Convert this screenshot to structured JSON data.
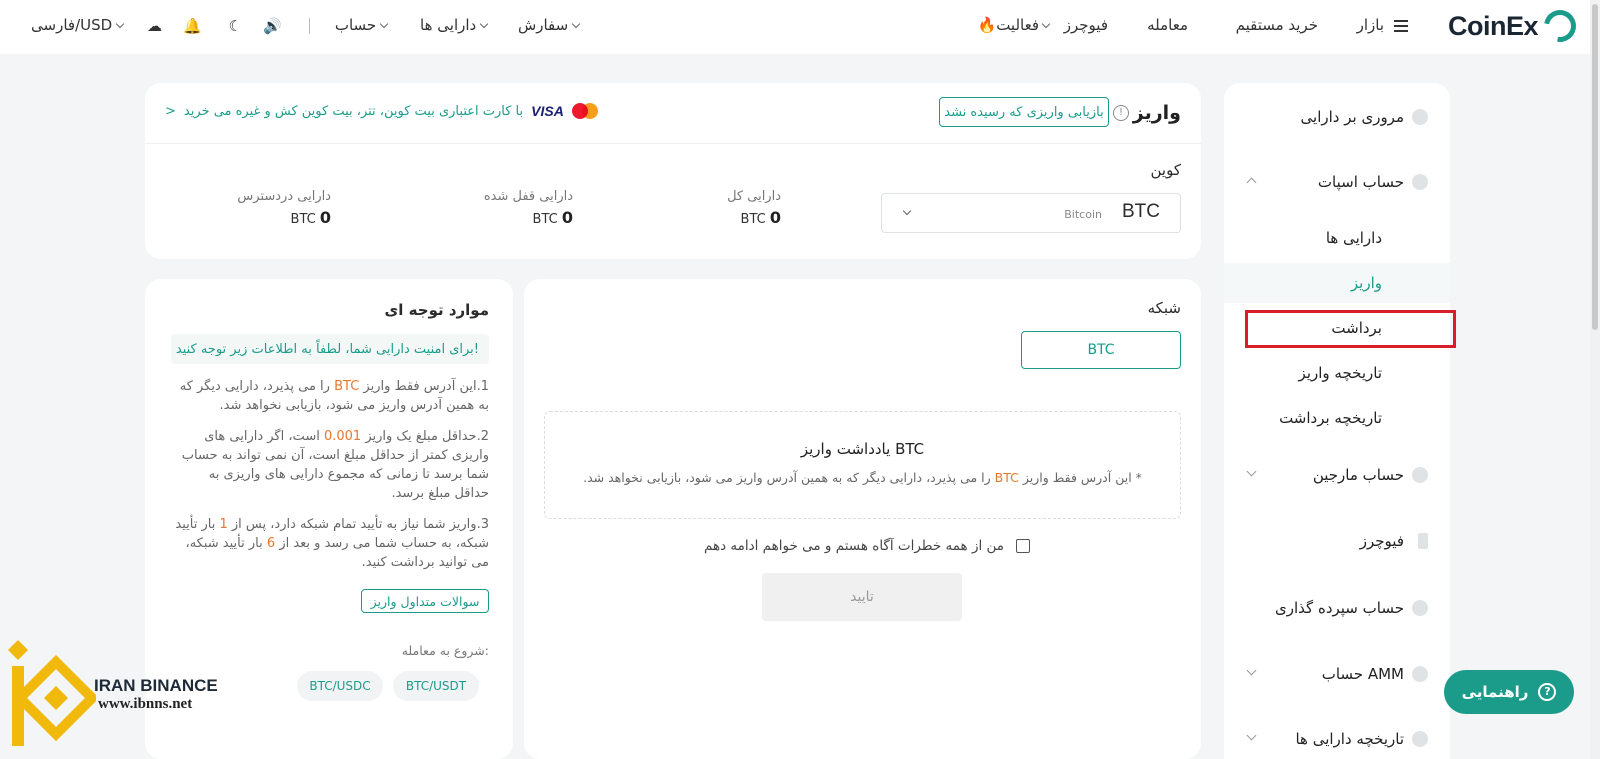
{
  "brand": {
    "name": "CoinEx",
    "color": "#1b9c8b"
  },
  "topnav": {
    "items": [
      "بازار",
      "خرید مستقیم",
      "معامله",
      "فیوچرز",
      "فعالیت",
      "سفارش",
      "دارایی ها",
      "حساب"
    ],
    "language": "فارسی/USD"
  },
  "sidebar": {
    "overview": "مروری بر دارایی",
    "spot": "حساب اسپات",
    "assets": "دارایی ها",
    "deposit": "واریز",
    "withdraw": "برداشت",
    "deposit_history": "تاریخچه واریز",
    "withdraw_history": "تاریخچه برداشت",
    "margin": "حساب مارجین",
    "futures": "فیوچرز",
    "savings": "حساب سپرده گذاری",
    "amm": "حساب AMM",
    "asset_history": "تاریخچه دارایی ها"
  },
  "deposit": {
    "title": "واریز",
    "recover_button": "بازیابی واریزی که رسیده نشد",
    "card_promo": "با کارت اعتباری بیت کوین، تتر، بیت کوین کش و غیره می خرید",
    "visa": "VISA",
    "coin_label": "کوین",
    "coin_symbol": "BTC",
    "coin_name": "Bitcoin",
    "balances": [
      {
        "label": "دارایی کل",
        "value": "0",
        "unit": "BTC"
      },
      {
        "label": "دارایی قفل شده",
        "value": "0",
        "unit": "BTC"
      },
      {
        "label": "دارایی دردسترس",
        "value": "0",
        "unit": "BTC"
      }
    ]
  },
  "network": {
    "label": "شبکه",
    "selected": "BTC",
    "memo_title": "یادداشت واریز BTC",
    "memo_text_pre": "* این آدرس فقط واریز",
    "memo_text_coin": "BTC",
    "memo_text_post": "را می پذیرد، دارایی دیگر که به همین آدرس واریز می شود، بازیابی نخواهد شد.",
    "checkbox_label": "من از همه خطرات آگاه هستم و می خواهم ادامه دهم",
    "confirm": "تایید"
  },
  "notes": {
    "title": "موارد توجه ای",
    "banner": "برای امنیت دارایی شما، لطفاً به اطلاعات زیر توجه کنید!",
    "n1_a": "1.این آدرس فقط واریز",
    "n1_coin": "BTC",
    "n1_b": "را می پذیرد، دارایی دیگر که به همین آدرس واریز می شود، بازیابی نخواهد شد.",
    "n2_a": "2.حداقل مبلغ یک واریز",
    "n2_amount": "0.001",
    "n2_b": "است، اگر دارایی های واریزی کمتر از حداقل مبلغ است، آن نمی تواند به حساب شما برسد تا زمانی که مجموع دارایی های واریزی به حداقل مبلغ برسد.",
    "n3_a": "3.واریز شما نیاز به تأیید تمام شبکه دارد، پس از",
    "n3_one": "1",
    "n3_b": "بار تأیید شبکه، به حساب شما می رسد و بعد از",
    "n3_six": "6",
    "n3_c": "بار تأیید شبکه، می توانید برداشت کنید.",
    "faq": "سوالات متداول واریز",
    "trade_label": "شروع به معامله:",
    "pairs": [
      "BTC/USDT",
      "BTC/USDC"
    ]
  },
  "help": {
    "label": "راهنمایی"
  },
  "watermark": {
    "line1": "IRAN BINANCE",
    "line2": "www.ibnns.net"
  }
}
